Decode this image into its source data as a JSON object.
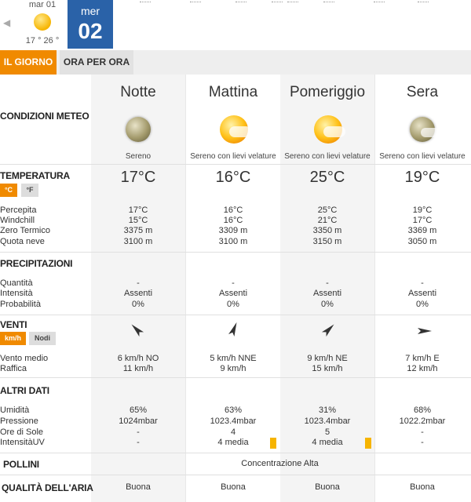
{
  "nav": {
    "prev_day": {
      "name": "mar 01",
      "range": "17 ° 26 °"
    },
    "current_day": {
      "name": "mer",
      "number": "02"
    }
  },
  "tabs": [
    {
      "label": "IL GIORNO",
      "active": true
    },
    {
      "label": "ORA PER ORA",
      "active": false
    }
  ],
  "sections": {
    "conditions": "CONDIZIONI METEO",
    "temperature": "TEMPERATURA",
    "precipitation": "PRECIPITAZIONI",
    "winds": "VENTI",
    "other": "ALTRI DATI",
    "pollen": "POLLINI",
    "air": "QUALITÀ DELL'ARIA"
  },
  "units": {
    "celsius": "°C",
    "fahrenheit": "°F",
    "kmh": "km/h",
    "knots": "Nodi"
  },
  "row_labels": {
    "perceived": "Percepita",
    "windchill": "Windchill",
    "zero_term": "Zero Termico",
    "snow_level": "Quota neve",
    "quantity": "Quantità",
    "intensity": "Intensità",
    "probability": "Probabilità",
    "avg_wind": "Vento medio",
    "gust": "Raffica",
    "humidity": "Umidità",
    "pressure": "Pressione",
    "sun_hours": "Ore di Sole",
    "uv": "IntensitàUV"
  },
  "pollen_value": "Concentrazione Alta",
  "accent_color": "#f08a00",
  "day_color": "#2a62a8",
  "periods": [
    {
      "name": "Notte",
      "icon": "moon-icon",
      "condition": "Sereno",
      "temp": "17°C",
      "perceived": "17°C",
      "windchill": "15°C",
      "zero_term": "3375 m",
      "snow_level": "3100 m",
      "quantity": "-",
      "intensity": "Assenti",
      "probability": "0%",
      "wind_dir_deg": 315,
      "avg_wind": "6 km/h  NO",
      "gust": "11 km/h",
      "humidity": "65%",
      "pressure": "1024mbar",
      "sun_hours": "-",
      "uv": "-",
      "air": "Buona"
    },
    {
      "name": "Mattina",
      "icon": "sun-veil-icon",
      "condition": "Sereno con lievi velature",
      "temp": "16°C",
      "perceived": "16°C",
      "windchill": "16°C",
      "zero_term": "3309 m",
      "snow_level": "3100 m",
      "quantity": "-",
      "intensity": "Assenti",
      "probability": "0%",
      "wind_dir_deg": 22,
      "avg_wind": "5 km/h NNE",
      "gust": "9 km/h",
      "humidity": "63%",
      "pressure": "1023.4mbar",
      "sun_hours": "4",
      "uv": "4 media",
      "air": "Buona"
    },
    {
      "name": "Pomeriggio",
      "icon": "sun-veil-icon",
      "condition": "Sereno con lievi velature",
      "temp": "25°C",
      "perceived": "25°C",
      "windchill": "21°C",
      "zero_term": "3350 m",
      "snow_level": "3150 m",
      "quantity": "-",
      "intensity": "Assenti",
      "probability": "0%",
      "wind_dir_deg": 45,
      "avg_wind": "9 km/h NE",
      "gust": "15 km/h",
      "humidity": "31%",
      "pressure": "1023.4mbar",
      "sun_hours": "5",
      "uv": "4 media",
      "air": "Buona"
    },
    {
      "name": "Sera",
      "icon": "moon-veil-icon",
      "condition": "Sereno con lievi velature",
      "temp": "19°C",
      "perceived": "19°C",
      "windchill": "17°C",
      "zero_term": "3369 m",
      "snow_level": "3050 m",
      "quantity": "-",
      "intensity": "Assenti",
      "probability": "0%",
      "wind_dir_deg": 90,
      "avg_wind": "7 km/h E",
      "gust": "12 km/h",
      "humidity": "68%",
      "pressure": "1022.2mbar",
      "sun_hours": "-",
      "uv": "-",
      "air": "Buona"
    }
  ]
}
